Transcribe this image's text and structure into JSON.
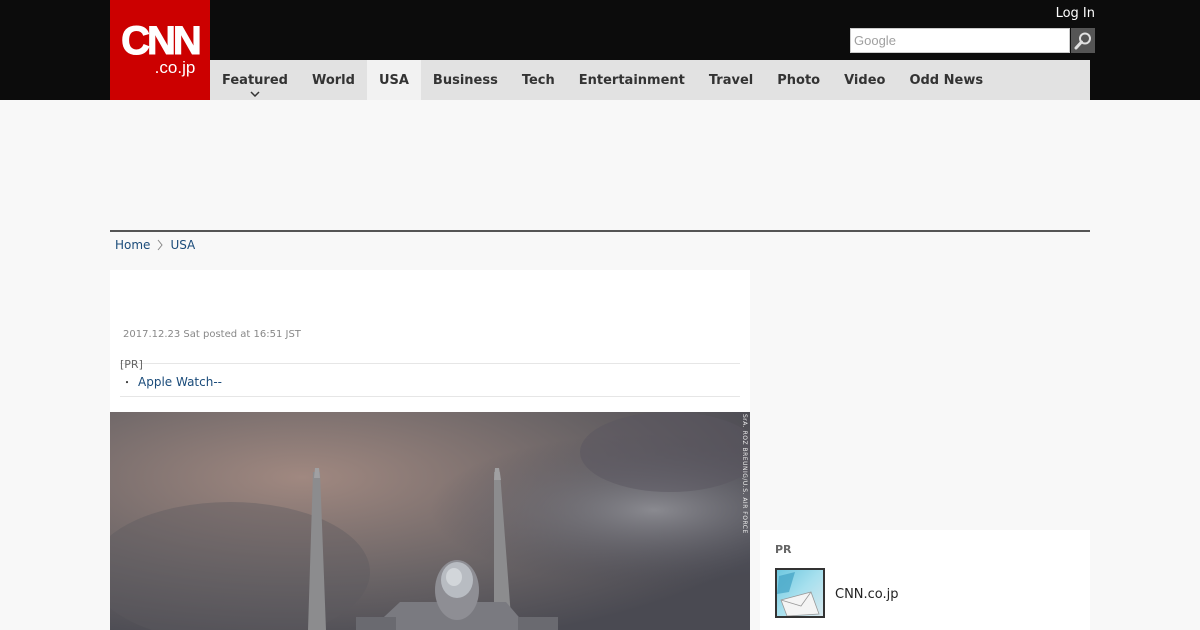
{
  "header": {
    "logo_main": "CNN",
    "logo_sub": ".co.jp",
    "login_label": "Log In",
    "search_placeholder": "Google"
  },
  "nav": {
    "items": [
      {
        "label": "Featured",
        "has_dropdown": true,
        "active": false
      },
      {
        "label": "World",
        "active": false
      },
      {
        "label": "USA",
        "active": true
      },
      {
        "label": "Business",
        "active": false
      },
      {
        "label": "Tech",
        "active": false
      },
      {
        "label": "Entertainment",
        "active": false
      },
      {
        "label": "Travel",
        "active": false
      },
      {
        "label": "Photo",
        "active": false
      },
      {
        "label": "Video",
        "active": false
      },
      {
        "label": "Odd News",
        "active": false
      }
    ]
  },
  "breadcrumb": {
    "items": [
      "Home",
      "USA"
    ]
  },
  "article": {
    "timestamp": "2017.12.23 Sat posted at 16:51 JST",
    "pr_tag": "[PR]",
    "pr_link": "Apple Watch--",
    "image_credit": "SrA. ROZ BREUNIG/U.S. AIR FORCE"
  },
  "sidebar": {
    "pr_title": "PR",
    "pr_item_label": "CNN.co.jp"
  },
  "colors": {
    "brand_red": "#cc0000",
    "topbar": "#0c0c0c",
    "nav_bg": "#e2e2e2",
    "link": "#1a4b7a"
  }
}
